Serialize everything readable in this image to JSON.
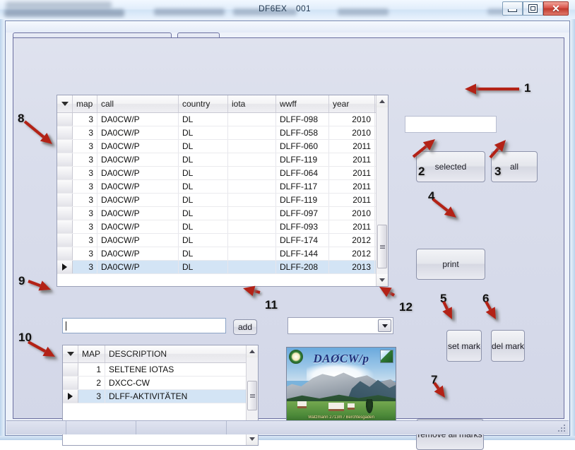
{
  "window": {
    "title_call": "DF6EX",
    "title_number": "001",
    "controls": {
      "minimize": "minimize-button",
      "maximize": "maximize-button",
      "close": "close-button",
      "close_glyph": "✕"
    }
  },
  "main_grid": {
    "columns": [
      "map",
      "call",
      "country",
      "iota",
      "wwff",
      "year"
    ],
    "rows": [
      {
        "map": "3",
        "call": "DA0CW/P",
        "country": "DL",
        "iota": "",
        "wwff": "DLFF-098",
        "year": "2010",
        "selected": false
      },
      {
        "map": "3",
        "call": "DA0CW/P",
        "country": "DL",
        "iota": "",
        "wwff": "DLFF-058",
        "year": "2010",
        "selected": false
      },
      {
        "map": "3",
        "call": "DA0CW/P",
        "country": "DL",
        "iota": "",
        "wwff": "DLFF-060",
        "year": "2011",
        "selected": false
      },
      {
        "map": "3",
        "call": "DA0CW/P",
        "country": "DL",
        "iota": "",
        "wwff": "DLFF-119",
        "year": "2011",
        "selected": false
      },
      {
        "map": "3",
        "call": "DA0CW/P",
        "country": "DL",
        "iota": "",
        "wwff": "DLFF-064",
        "year": "2011",
        "selected": false
      },
      {
        "map": "3",
        "call": "DA0CW/P",
        "country": "DL",
        "iota": "",
        "wwff": "DLFF-117",
        "year": "2011",
        "selected": false
      },
      {
        "map": "3",
        "call": "DA0CW/P",
        "country": "DL",
        "iota": "",
        "wwff": "DLFF-119",
        "year": "2011",
        "selected": false
      },
      {
        "map": "3",
        "call": "DA0CW/P",
        "country": "DL",
        "iota": "",
        "wwff": "DLFF-097",
        "year": "2010",
        "selected": false
      },
      {
        "map": "3",
        "call": "DA0CW/P",
        "country": "DL",
        "iota": "",
        "wwff": "DLFF-093",
        "year": "2011",
        "selected": false
      },
      {
        "map": "3",
        "call": "DA0CW/P",
        "country": "DL",
        "iota": "",
        "wwff": "DLFF-174",
        "year": "2012",
        "selected": false
      },
      {
        "map": "3",
        "call": "DA0CW/P",
        "country": "DL",
        "iota": "",
        "wwff": "DLFF-144",
        "year": "2012",
        "selected": false
      },
      {
        "map": "3",
        "call": "DA0CW/P",
        "country": "DL",
        "iota": "",
        "wwff": "DLFF-208",
        "year": "2013",
        "selected": true
      }
    ]
  },
  "desc_grid": {
    "columns": [
      "MAP",
      "DESCRIPTION"
    ],
    "rows": [
      {
        "map": "1",
        "description": "SELTENE IOTAS",
        "selected": false
      },
      {
        "map": "2",
        "description": "DXCC-CW",
        "selected": false
      },
      {
        "map": "3",
        "description": "DLFF-AKTIVITÄTEN",
        "selected": true
      }
    ]
  },
  "inputs": {
    "top_textbox_value": "",
    "desc_textbox_value": "",
    "combo_value": ""
  },
  "buttons": {
    "selected": "selected",
    "all": "all",
    "print": "print",
    "set_mark": "set mark",
    "del_mark": "del mark",
    "remove_all_marks": "remove all marks",
    "add": "add"
  },
  "qsl_card": {
    "callsign": "DAØCW/p",
    "caption": "Watzmann 2713m / Berchtesgaden"
  },
  "annotations": [
    {
      "id": "1",
      "target": "top-textbox"
    },
    {
      "id": "2",
      "target": "selected-button"
    },
    {
      "id": "3",
      "target": "all-button"
    },
    {
      "id": "4",
      "target": "print-button"
    },
    {
      "id": "5",
      "target": "set-mark-button"
    },
    {
      "id": "6",
      "target": "del-mark-button"
    },
    {
      "id": "7",
      "target": "remove-all-marks-button"
    },
    {
      "id": "8",
      "target": "main-grid-row-headers"
    },
    {
      "id": "9",
      "target": "description-textbox"
    },
    {
      "id": "10",
      "target": "description-grid-row-selector"
    },
    {
      "id": "11",
      "target": "add-button"
    },
    {
      "id": "12",
      "target": "combo-dropdown"
    }
  ],
  "colors": {
    "accent_red": "#b32118",
    "form_bg": "#d6dae9",
    "selection_blue": "#d3e4f5",
    "titlebar_blue": "#dce9f7"
  }
}
